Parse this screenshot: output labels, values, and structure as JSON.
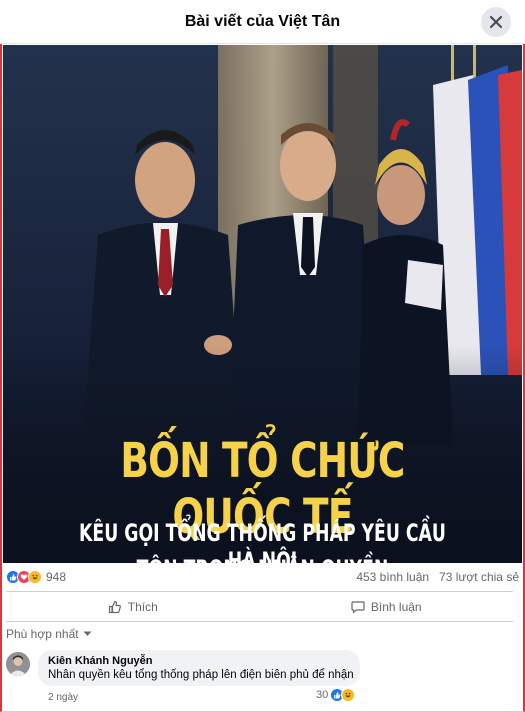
{
  "dialog": {
    "title": "Bài viết của Việt Tân",
    "close_icon": "close-icon"
  },
  "post_image": {
    "headline_line1": "BỐN TỔ CHỨC QUỐC TẾ",
    "headline_line2": "KÊU GỌI TỔNG THỐNG PHÁP YÊU CẦU HÀ NỘI",
    "headline_line3": "TÔN TRỌNG NHÂN QUYỀN",
    "headline_color": "#f5d24a"
  },
  "stats": {
    "reaction_icons": [
      "like-icon",
      "love-icon",
      "haha-icon"
    ],
    "reaction_count": "948",
    "comments": "453 bình luận",
    "shares": "73 lượt chia sẻ"
  },
  "actions": {
    "like_label": "Thích",
    "comment_label": "Bình luận"
  },
  "comments_sort": {
    "label": "Phù hợp nhất"
  },
  "comments": [
    {
      "author": "Kiên Khánh Nguyễn",
      "text": "Nhân quyền kêu tổng thống pháp lên điện biên phủ để nhận",
      "time": "2 ngày",
      "reaction_count": "30"
    }
  ],
  "colors": {
    "like_blue": "#1877f2",
    "love_red": "#f33e58",
    "haha_yellow": "#f7b928",
    "text_secondary": "#65676b"
  }
}
